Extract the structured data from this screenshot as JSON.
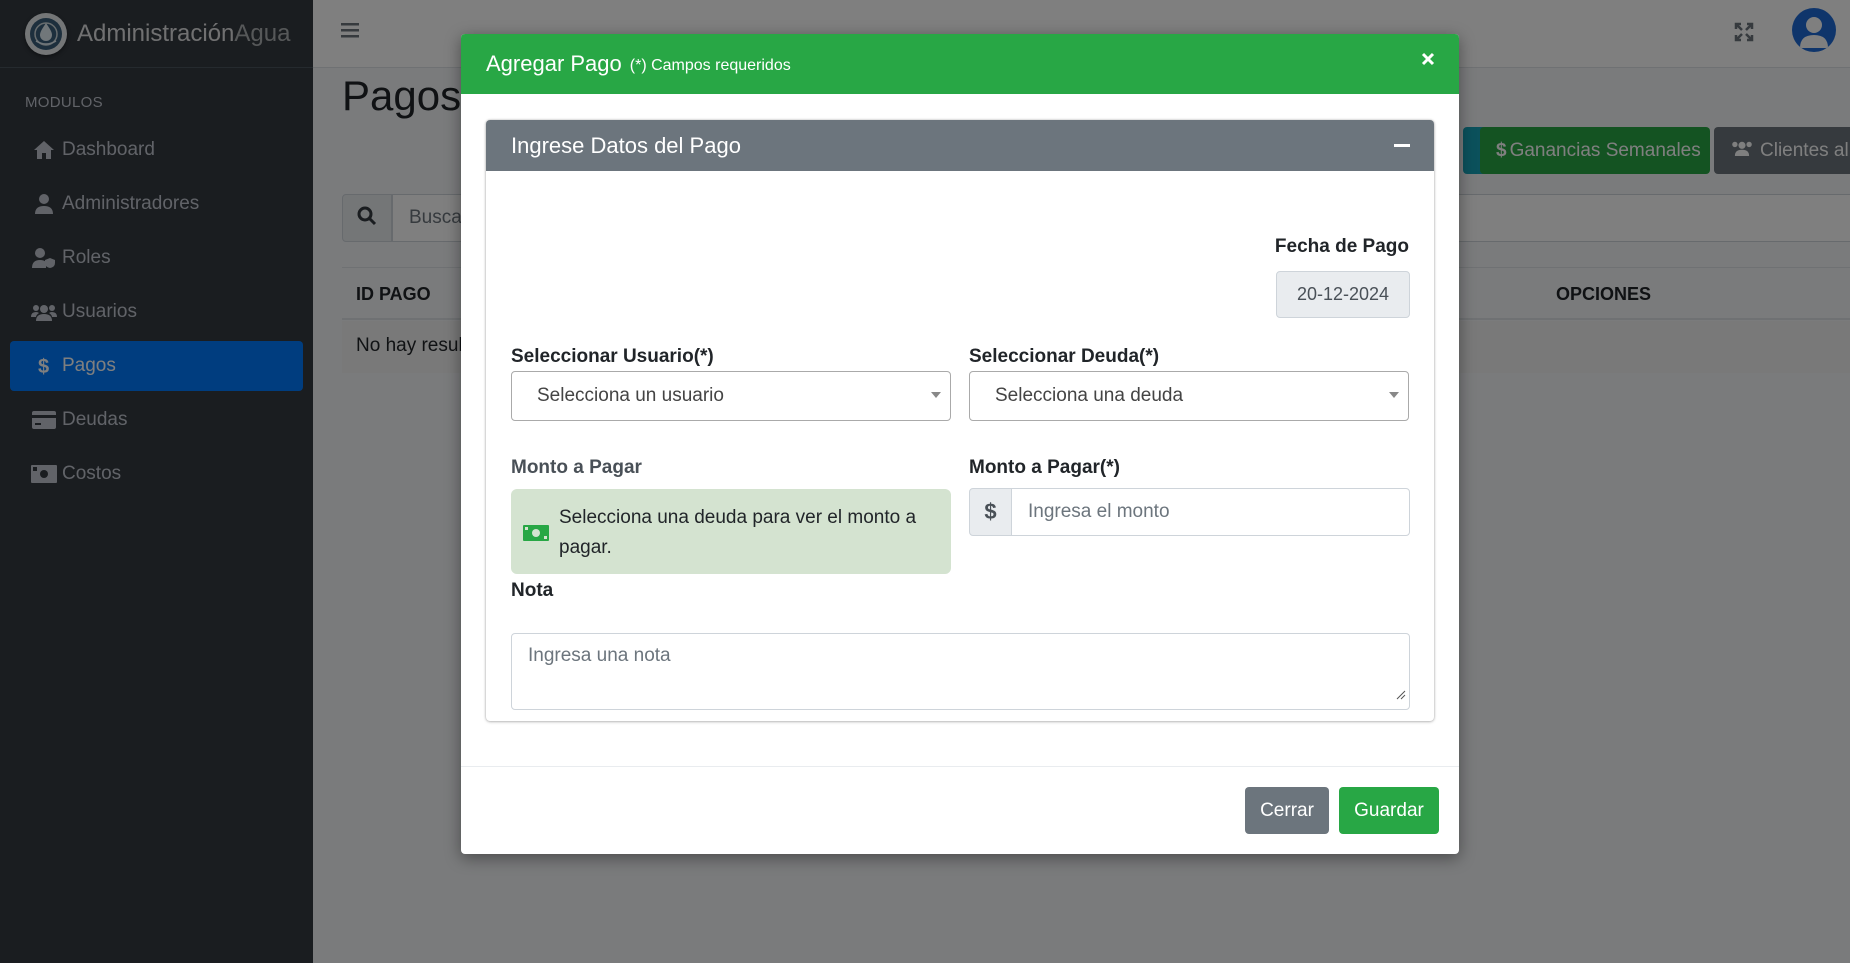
{
  "sidebar": {
    "brand_main": "Administración",
    "brand_light": "Agua",
    "header": "MODULOS",
    "items": [
      {
        "label": "Dashboard",
        "icon": "home-icon"
      },
      {
        "label": "Administradores",
        "icon": "user-icon"
      },
      {
        "label": "Roles",
        "icon": "user-shield-icon"
      },
      {
        "label": "Usuarios",
        "icon": "users-icon"
      },
      {
        "label": "Pagos",
        "icon": "dollar-icon",
        "active": true
      },
      {
        "label": "Deudas",
        "icon": "credit-card-icon"
      },
      {
        "label": "Costos",
        "icon": "money-bill-icon"
      }
    ]
  },
  "page": {
    "title": "Pagos",
    "buttons": {
      "ganancias": "Ganancias Semanales",
      "clientes": "Clientes al"
    },
    "search_placeholder": "Busca",
    "table": {
      "col_id": "ID PAGO",
      "col_opciones": "OPCIONES",
      "empty_text": "No hay resul"
    }
  },
  "modal": {
    "title": "Agregar Pago",
    "subtitle": "(*) Campos requeridos",
    "card_title": "Ingrese Datos del Pago",
    "fecha_label": "Fecha de Pago",
    "fecha_value": "20-12-2024",
    "usuario_label": "Seleccionar Usuario(*)",
    "usuario_placeholder": "Selecciona un usuario",
    "deuda_label": "Seleccionar Deuda(*)",
    "deuda_placeholder": "Selecciona una deuda",
    "monto_label": "Monto a Pagar",
    "monto_info": "Selecciona una deuda para ver el monto a pagar.",
    "monto_req_label": "Monto a Pagar(*)",
    "currency_symbol": "$",
    "monto_placeholder": "Ingresa el monto",
    "nota_label": "Nota",
    "nota_placeholder": "Ingresa una nota",
    "cerrar_label": "Cerrar",
    "guardar_label": "Guardar"
  },
  "colors": {
    "success": "#28a745",
    "primary": "#007bff",
    "secondary": "#6c757d",
    "sidebar": "#343a40"
  }
}
